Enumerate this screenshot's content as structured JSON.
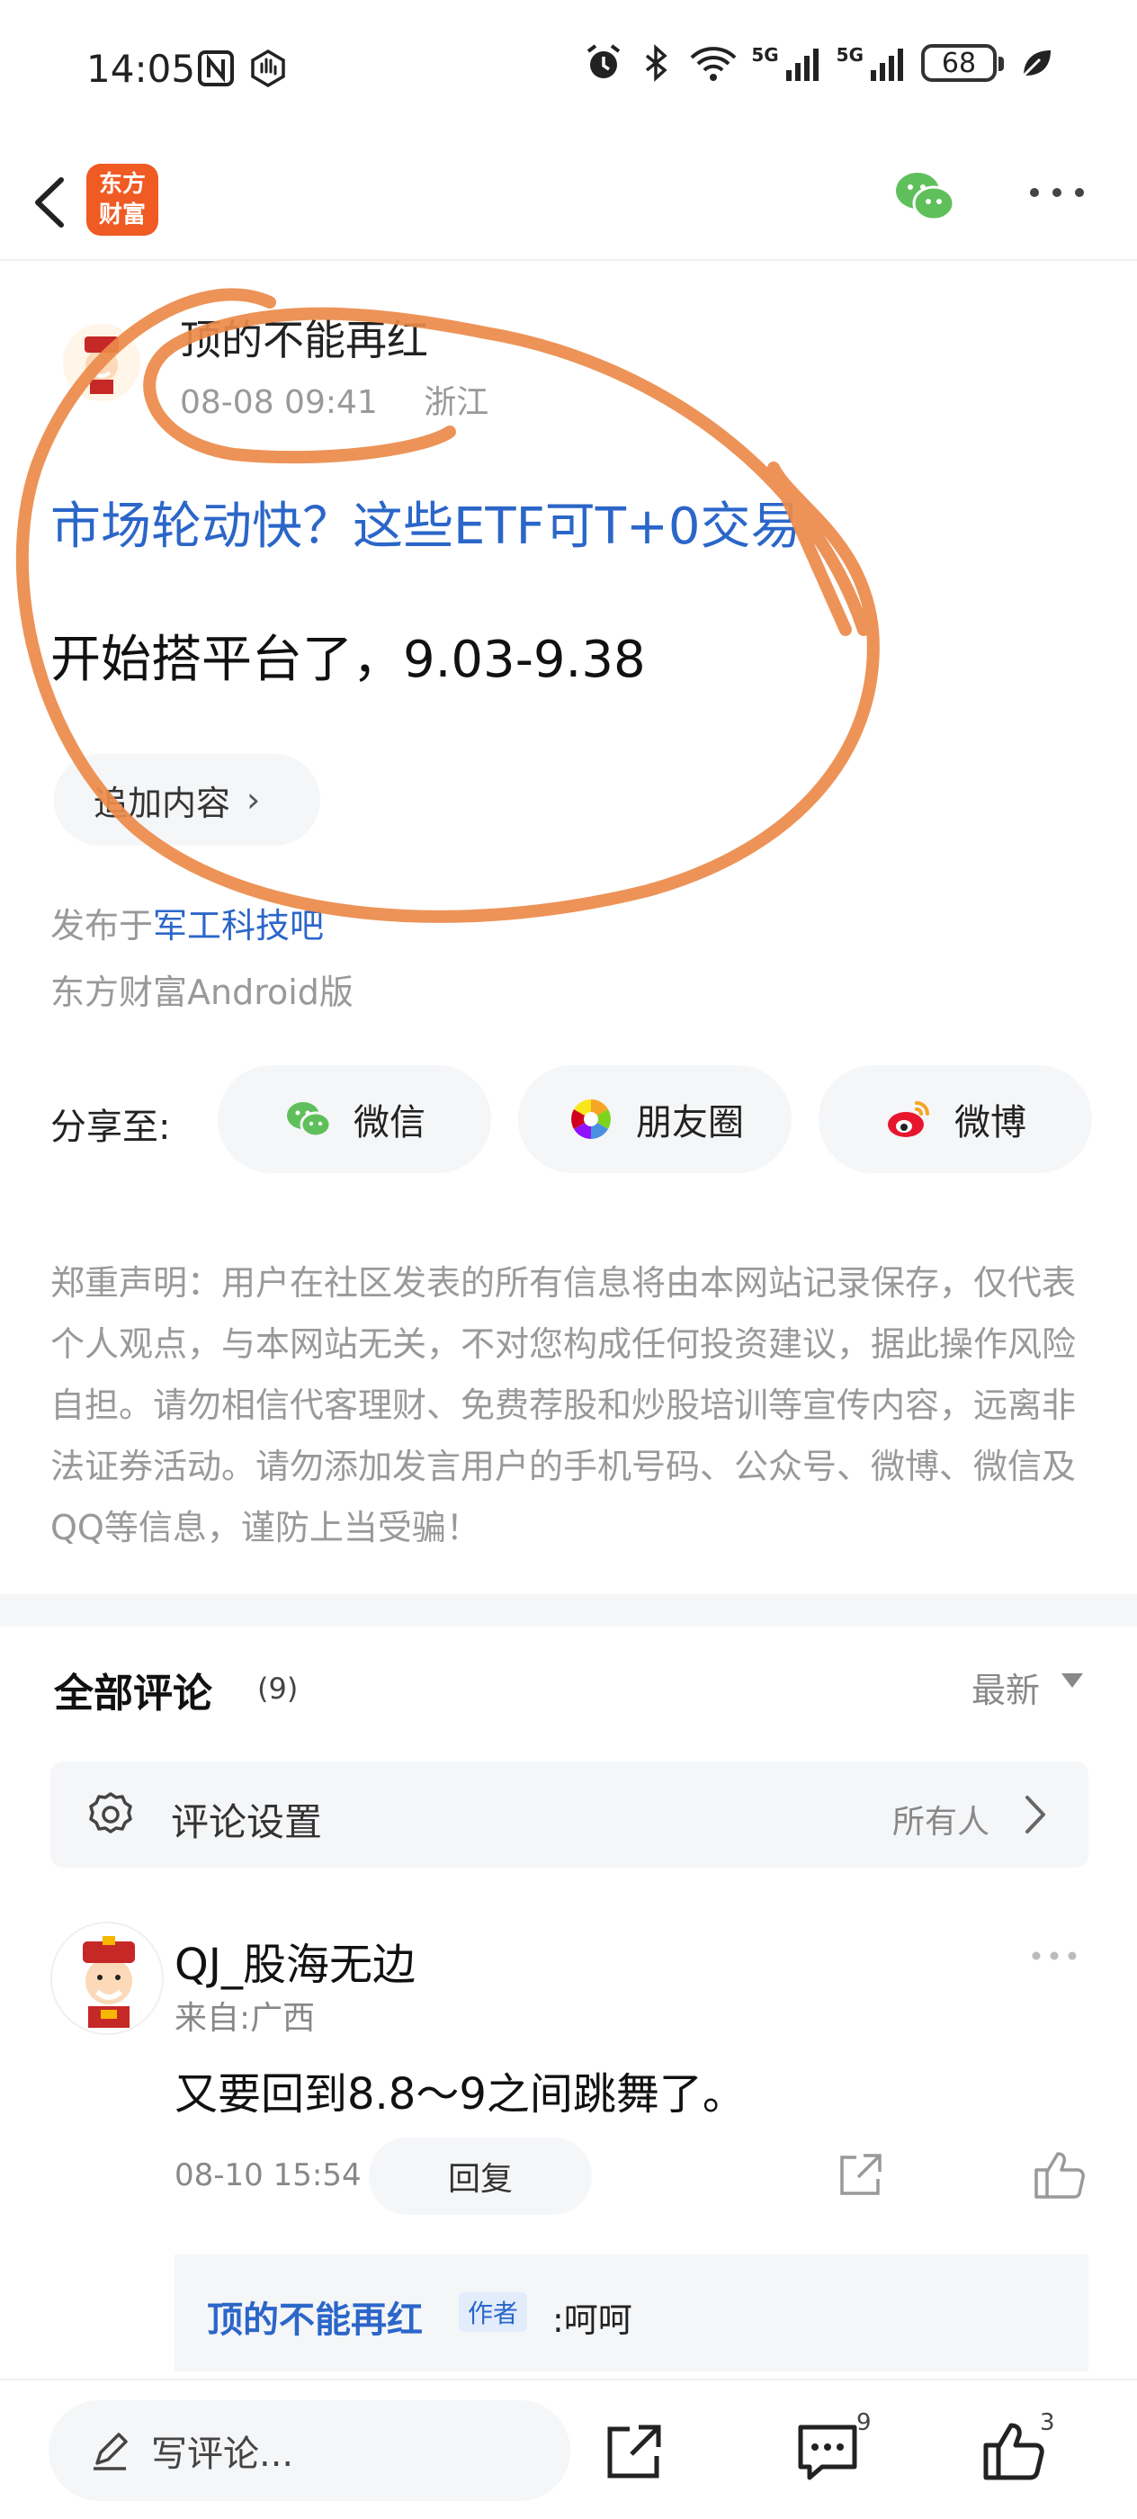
{
  "status_bar": {
    "time": "14:05",
    "network_1": "5G",
    "network_2": "5G",
    "battery": "68"
  },
  "header": {
    "logo_line1": "东方",
    "logo_line2": "财富"
  },
  "post": {
    "author": "顶的不能再红",
    "date": "08-08 09:41",
    "location": "浙江",
    "title": "市场轮动快？这些ETF可T+0交易",
    "body": "开始搭平台了，9.03-9.38",
    "append_label": "追加内容",
    "source_prefix": "发布于",
    "source_link": "军工科技吧",
    "client": "东方财富Android版"
  },
  "share": {
    "label": "分享至:",
    "wechat": "微信",
    "moments": "朋友圈",
    "weibo": "微博"
  },
  "disclaimer": "郑重声明：用户在社区发表的所有信息将由本网站记录保存，仅代表个人观点，与本网站无关，不对您构成任何投资建议，据此操作风险自担。请勿相信代客理财、免费荐股和炒股培训等宣传内容，远离非法证券活动。请勿添加发言用户的手机号码、公众号、微博、微信及QQ等信息，谨防上当受骗！",
  "comments": {
    "title": "全部评论",
    "count": "(9)",
    "sort": "最新",
    "settings_label": "评论设置",
    "settings_value": "所有人",
    "items": [
      {
        "name": "QJ_股海无边",
        "from": "来自:广西",
        "text": "又要回到8.8～9之间跳舞了。",
        "time": "08-10 15:54",
        "reply_label": "回复",
        "sub_reply": {
          "author": "顶的不能再红",
          "badge": "作者",
          "text": ":呵呵"
        }
      }
    ]
  },
  "bottom_bar": {
    "write_placeholder": "写评论...",
    "comment_count": "9",
    "like_count": "3"
  },
  "colors": {
    "link_blue": "#2b66c9",
    "brand_orange": "#f05a23",
    "annotation_orange": "#ec8a4a",
    "wechat_green": "#5fc05b",
    "weibo_red": "#e6162d"
  }
}
